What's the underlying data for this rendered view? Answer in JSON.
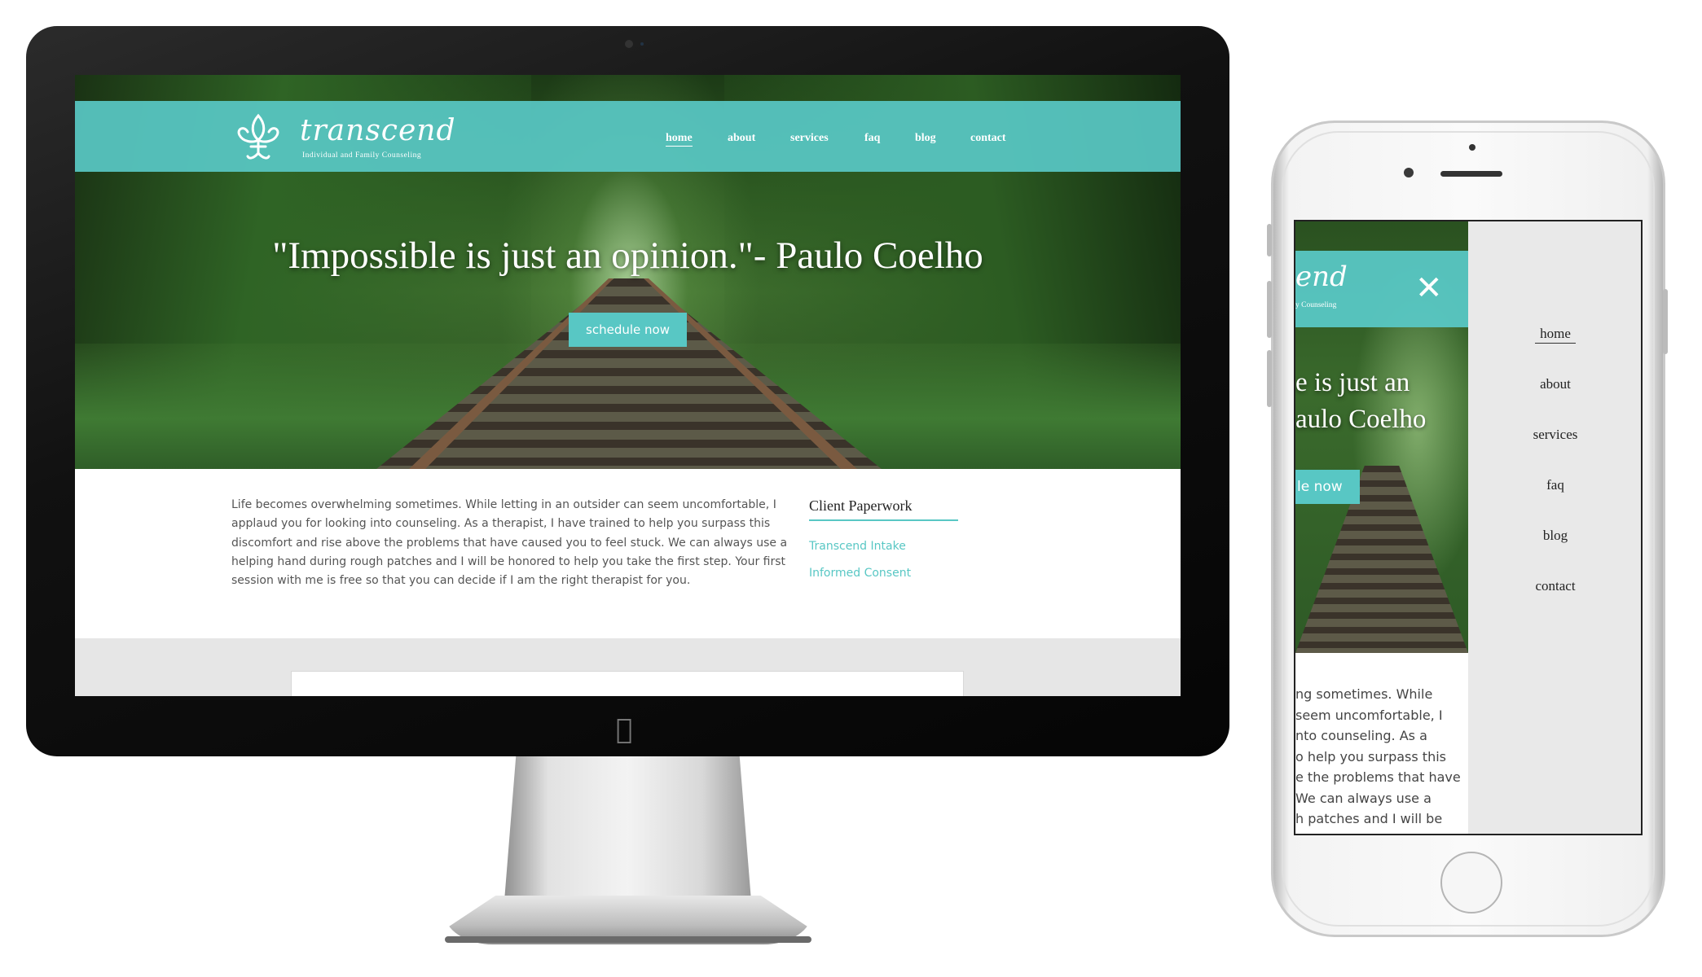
{
  "brand": {
    "name": "transcend",
    "tagline": "Individual and Family Counseling",
    "accent_color": "#58c7c4"
  },
  "desktop": {
    "nav": {
      "items": [
        {
          "label": "home",
          "active": true
        },
        {
          "label": "about"
        },
        {
          "label": "services"
        },
        {
          "label": "faq"
        },
        {
          "label": "blog"
        },
        {
          "label": "contact"
        }
      ]
    },
    "hero": {
      "quote": "\"Impossible is just an opinion.\"- Paulo Coelho",
      "cta_label": "schedule now"
    },
    "intro_text": "Life becomes overwhelming sometimes. While letting in an outsider can seem uncomfortable, I applaud you for looking into counseling. As a therapist, I have trained to help you surpass this discomfort and rise above the problems that have caused you to feel stuck. We can always use a helping hand during rough patches and I will be honored to help you take the first step. Your first session with me is free so that you can decide if I am the right therapist for you.",
    "sidebar": {
      "title": "Client Paperwork",
      "links": [
        "Transcend Intake",
        "Informed Consent"
      ]
    }
  },
  "mobile": {
    "brand_partial": "end",
    "tagline_partial": "y Counseling",
    "close_icon": "close-icon",
    "quote_lines": [
      "e is just an",
      "aulo Coelho"
    ],
    "cta_partial": "le now",
    "text_lines": [
      "ng sometimes. While",
      "seem uncomfortable, I",
      "nto counseling. As a",
      "o help you surpass this",
      "e the problems that have",
      "We can always use a",
      "h patches and I will be"
    ],
    "menu": [
      "home",
      "about",
      "services",
      "faq",
      "blog",
      "contact"
    ],
    "menu_active": "home"
  },
  "device_icons": {
    "monitor_logo": "apple-logo-icon"
  }
}
